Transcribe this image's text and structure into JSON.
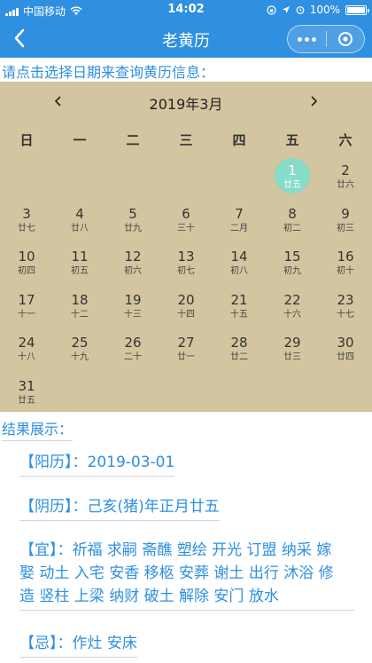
{
  "status": {
    "carrier": "中国移动",
    "time": "14:02",
    "battery": "100%"
  },
  "nav": {
    "title": "老黄历"
  },
  "prompt": "请点击选择日期来查询黄历信息：",
  "calendar": {
    "month_label": "2019年3月",
    "weekdays": [
      "日",
      "一",
      "二",
      "三",
      "四",
      "五",
      "六"
    ],
    "days": [
      {
        "day": "1",
        "lunar": "廿五",
        "selected": true
      },
      {
        "day": "2",
        "lunar": "廿六"
      },
      {
        "day": "3",
        "lunar": "廿七"
      },
      {
        "day": "4",
        "lunar": "廿八"
      },
      {
        "day": "5",
        "lunar": "廿九"
      },
      {
        "day": "6",
        "lunar": "三十"
      },
      {
        "day": "7",
        "lunar": "二月"
      },
      {
        "day": "8",
        "lunar": "初二"
      },
      {
        "day": "9",
        "lunar": "初三"
      },
      {
        "day": "10",
        "lunar": "初四"
      },
      {
        "day": "11",
        "lunar": "初五"
      },
      {
        "day": "12",
        "lunar": "初六"
      },
      {
        "day": "13",
        "lunar": "初七"
      },
      {
        "day": "14",
        "lunar": "初八"
      },
      {
        "day": "15",
        "lunar": "初九"
      },
      {
        "day": "16",
        "lunar": "初十"
      },
      {
        "day": "17",
        "lunar": "十一"
      },
      {
        "day": "18",
        "lunar": "十二"
      },
      {
        "day": "19",
        "lunar": "十三"
      },
      {
        "day": "20",
        "lunar": "十四"
      },
      {
        "day": "21",
        "lunar": "十五"
      },
      {
        "day": "22",
        "lunar": "十六"
      },
      {
        "day": "23",
        "lunar": "十七"
      },
      {
        "day": "24",
        "lunar": "十八"
      },
      {
        "day": "25",
        "lunar": "十九"
      },
      {
        "day": "26",
        "lunar": "二十"
      },
      {
        "day": "27",
        "lunar": "廿一"
      },
      {
        "day": "28",
        "lunar": "廿二"
      },
      {
        "day": "29",
        "lunar": "廿三"
      },
      {
        "day": "30",
        "lunar": "廿四"
      },
      {
        "day": "31",
        "lunar": "廿五"
      }
    ]
  },
  "result": {
    "title": "结果展示：",
    "solar_tag": "【阳历】：",
    "solar_value": "2019-03-01",
    "lunar_tag": "【阴历】：",
    "lunar_value": "己亥(猪)年正月廿五",
    "yi_tag": "【宜】：",
    "yi_line1": "祈福 求嗣 斋醮 塑绘 开光 订盟 纳采 嫁",
    "yi_line2": "娶 动土 入宅 安香 移柩 安葬 谢土 出行 沐浴 修",
    "yi_line3": "造 竖柱 上梁 纳财 破土 解除 安门 放水",
    "ji_tag": "【忌】：",
    "ji_value": "作灶 安床"
  },
  "colors": {
    "brand": "#2f8fe0",
    "calendar_bg": "#d3c59f",
    "selected": "#86dcc8"
  }
}
